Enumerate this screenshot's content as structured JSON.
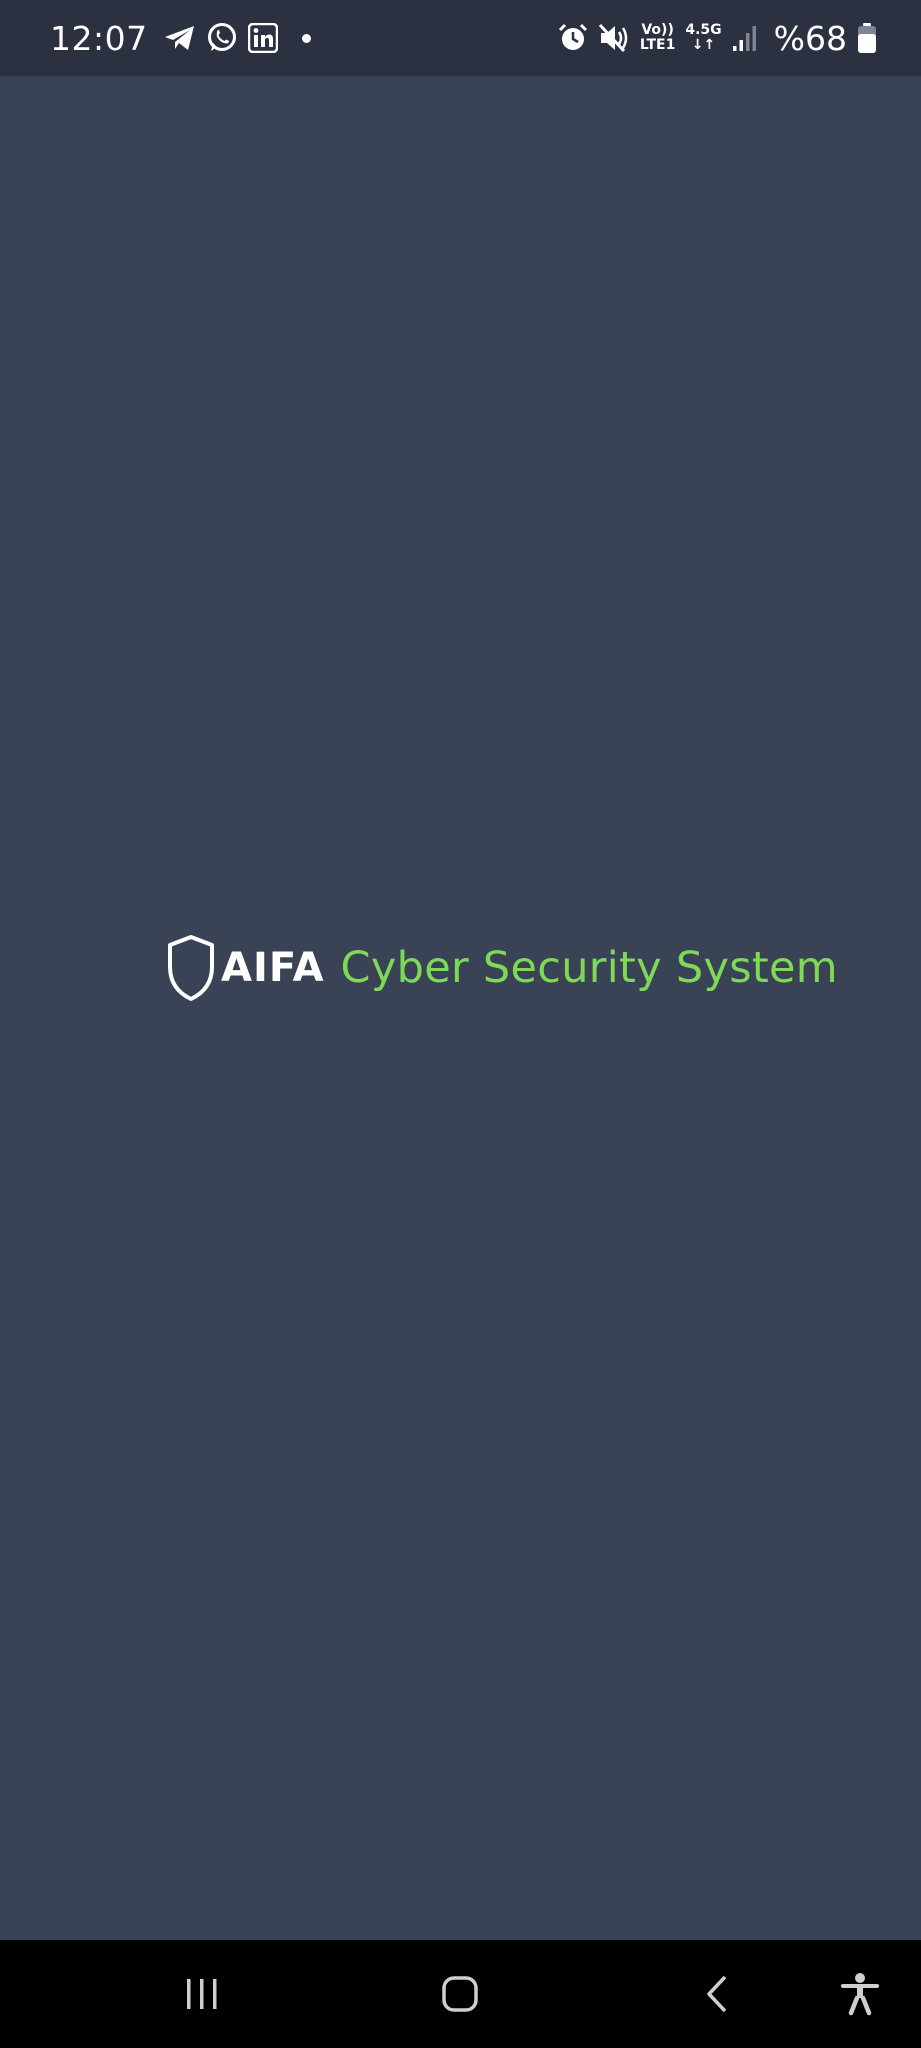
{
  "status_bar": {
    "time": "12:07",
    "left_icons": [
      "telegram-icon",
      "whatsapp-icon",
      "linkedin-icon",
      "notification-dot"
    ],
    "right_icons": [
      "alarm-icon",
      "mute-icon",
      "volte-icon",
      "network-icon",
      "signal-icon",
      "battery-icon"
    ],
    "volte_top": "Vo))",
    "volte_bottom": "LTE1",
    "network_top": "4.5G",
    "network_bottom": "↓↑",
    "battery": "%68"
  },
  "splash": {
    "brand": "AIFA",
    "tagline": "Cyber Security System",
    "brand_color": "#ffffff",
    "tagline_color": "#7ed957",
    "background": "#3a4355"
  },
  "nav_bar": {
    "buttons": [
      "recent-apps",
      "home",
      "back",
      "accessibility"
    ]
  }
}
